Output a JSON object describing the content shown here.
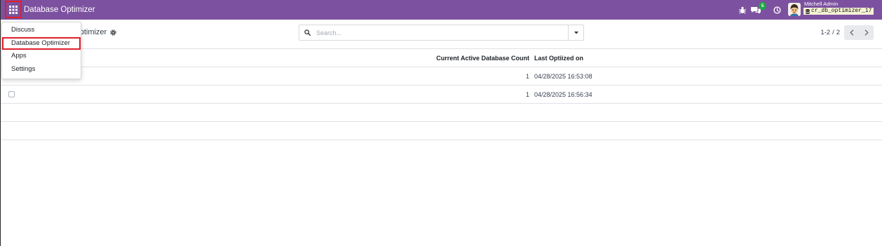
{
  "navbar": {
    "title": "Database Optimizer",
    "chat_badge_count": "5",
    "apps_button": {
      "highlighted": true
    },
    "user": {
      "name": "Mitchell Admin",
      "database": "cr_db_optimizer_17"
    }
  },
  "apps_menu": {
    "items": [
      {
        "label": "Discuss",
        "highlighted": false
      },
      {
        "label": "Database Optimizer",
        "highlighted": true
      },
      {
        "label": "Apps",
        "highlighted": false
      },
      {
        "label": "Settings",
        "highlighted": false
      }
    ]
  },
  "control_panel": {
    "breadcrumb": "Database Optimizer",
    "search": {
      "placeholder": "Search..."
    },
    "pager": {
      "value": "1-2",
      "separator": "/",
      "limit": "2"
    }
  },
  "list": {
    "headers": {
      "count": "Current Active Database Count",
      "last_optimized": "Last Optiized on"
    },
    "rows": [
      {
        "count": "1",
        "last_optimized": "04/28/2025 16:53:08"
      },
      {
        "count": "1",
        "last_optimized": "04/28/2025 16:56:34"
      }
    ]
  },
  "icons": {
    "apps": "apps-grid-icon",
    "debug": "bug-icon",
    "chat": "chat-icon",
    "activity": "clock-icon",
    "database": "database-icon",
    "breadcrumb_actions": "gear-icon",
    "search": "search-icon",
    "search_toggle": "caret-down-icon",
    "pager_prev": "chevron-left-icon",
    "pager_next": "chevron-right-icon"
  },
  "colors": {
    "navbar": "#7C519F",
    "highlight_border": "#E01E2B",
    "chat_badge": "#22A447"
  }
}
